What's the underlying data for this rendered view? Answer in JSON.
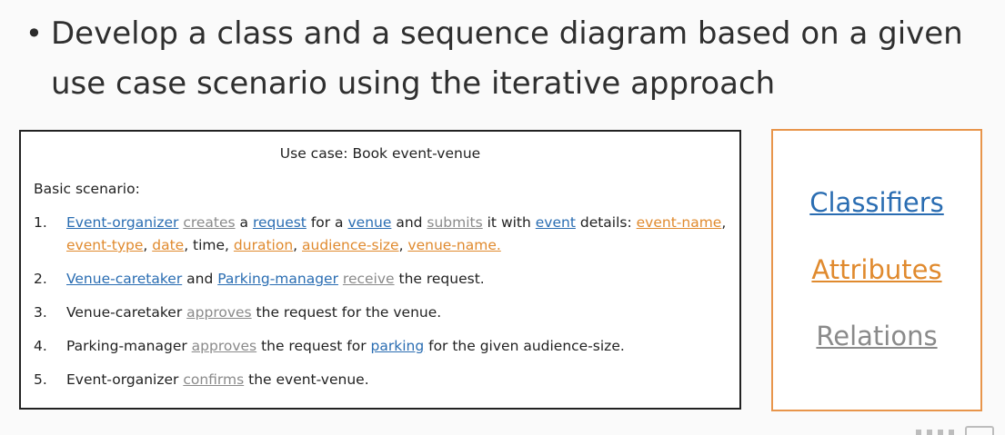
{
  "bullet": {
    "symbol": "•",
    "line1": "Develop a class and a sequence diagram based on a given",
    "line2": "use case scenario using the iterative approach"
  },
  "use_case": {
    "title": "Use case: Book event-venue",
    "scenario_label": "Basic scenario:",
    "steps": [
      {
        "number": "1.",
        "segments": [
          {
            "text": "Event-organizer",
            "style": "classifier"
          },
          {
            "text": " ",
            "style": "plain"
          },
          {
            "text": "creates",
            "style": "relation"
          },
          {
            "text": " a ",
            "style": "plain"
          },
          {
            "text": "request",
            "style": "classifier"
          },
          {
            "text": " for a ",
            "style": "plain"
          },
          {
            "text": "venue",
            "style": "classifier"
          },
          {
            "text": " and ",
            "style": "plain"
          },
          {
            "text": "submits",
            "style": "relation"
          },
          {
            "text": " it with ",
            "style": "plain"
          },
          {
            "text": "event",
            "style": "classifier"
          },
          {
            "text": " details: ",
            "style": "plain"
          },
          {
            "text": "event-name",
            "style": "attribute"
          },
          {
            "text": ", ",
            "style": "plain"
          },
          {
            "text": "event-type",
            "style": "attribute"
          },
          {
            "text": ", ",
            "style": "plain"
          },
          {
            "text": "date",
            "style": "attribute"
          },
          {
            "text": ", time, ",
            "style": "plain"
          },
          {
            "text": "duration",
            "style": "attribute"
          },
          {
            "text": ", ",
            "style": "plain"
          },
          {
            "text": "audience-size",
            "style": "attribute"
          },
          {
            "text": ", ",
            "style": "plain"
          },
          {
            "text": "venue-name.",
            "style": "attribute"
          }
        ]
      },
      {
        "number": "2.",
        "segments": [
          {
            "text": "Venue-caretaker",
            "style": "classifier"
          },
          {
            "text": " and ",
            "style": "plain"
          },
          {
            "text": "Parking-manager",
            "style": "classifier"
          },
          {
            "text": " ",
            "style": "plain"
          },
          {
            "text": "receive",
            "style": "relation"
          },
          {
            "text": " the request.",
            "style": "plain"
          }
        ]
      },
      {
        "number": "3.",
        "segments": [
          {
            "text": "Venue-caretaker ",
            "style": "plain"
          },
          {
            "text": "approves",
            "style": "relation"
          },
          {
            "text": " the request for the venue.",
            "style": "plain"
          }
        ]
      },
      {
        "number": "4.",
        "segments": [
          {
            "text": "Parking-manager ",
            "style": "plain"
          },
          {
            "text": "approves",
            "style": "relation"
          },
          {
            "text": " the request for ",
            "style": "plain"
          },
          {
            "text": "parking",
            "style": "classifier"
          },
          {
            "text": " for the given audience-size.",
            "style": "plain"
          }
        ]
      },
      {
        "number": "5.",
        "segments": [
          {
            "text": "Event-organizer ",
            "style": "plain"
          },
          {
            "text": "confirms",
            "style": "relation"
          },
          {
            "text": " the event-venue.",
            "style": "plain"
          }
        ]
      }
    ]
  },
  "legend": {
    "classifiers": "Classifiers",
    "attributes": "Attributes",
    "relations": "Relations"
  },
  "colors": {
    "classifier": "#2a6db2",
    "attribute": "#e08a2e",
    "relation": "#8a8a8a",
    "legend_border": "#e8954b"
  }
}
